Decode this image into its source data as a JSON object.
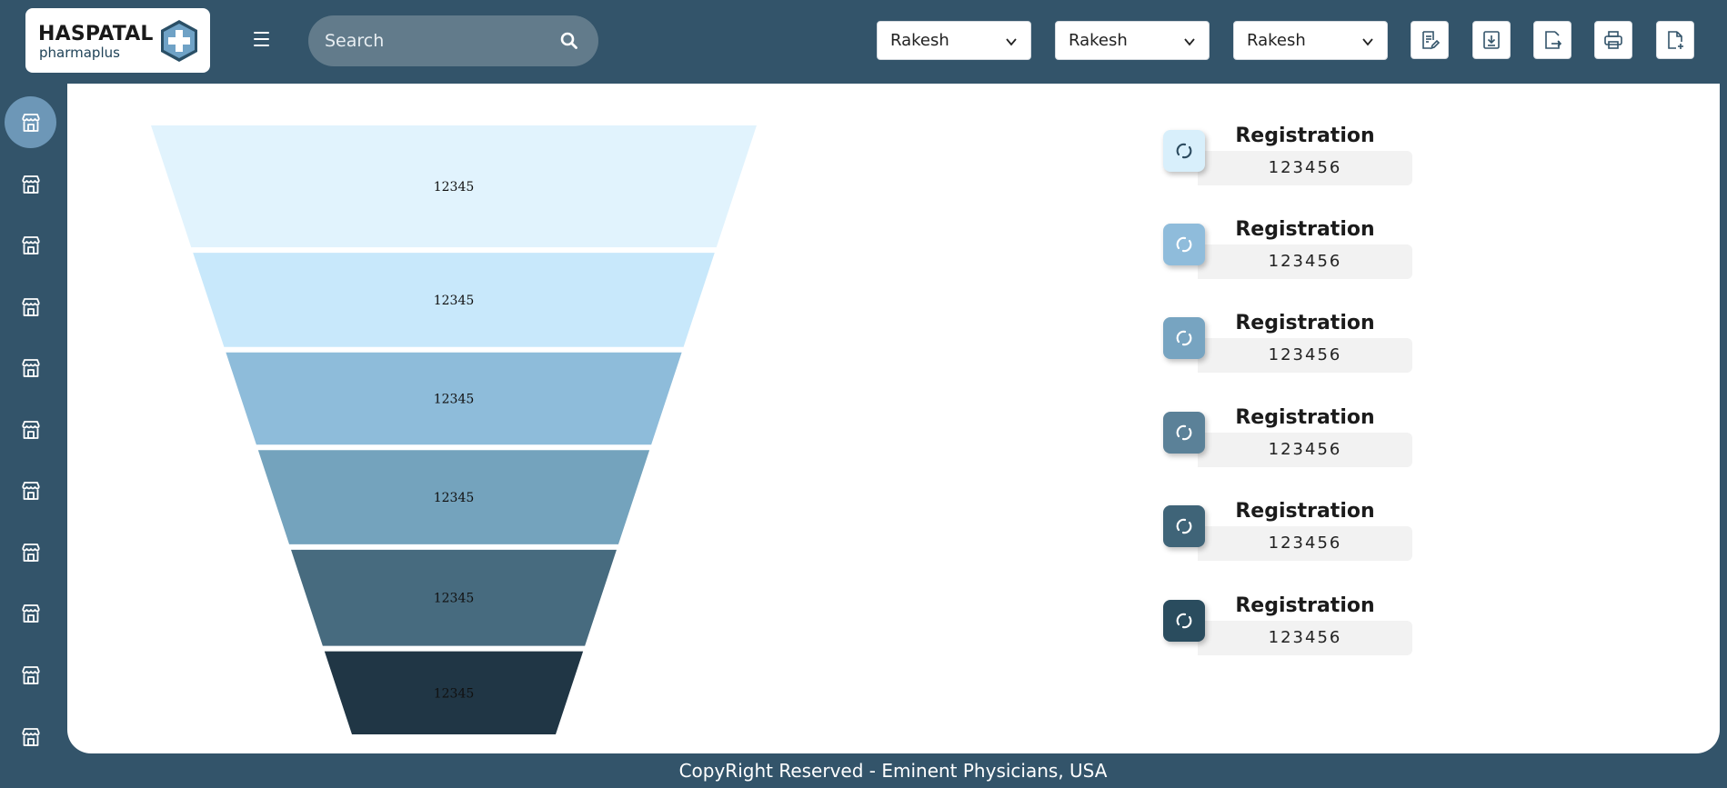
{
  "header": {
    "logo": {
      "title": "HASPATAL",
      "subtitle": "pharmaplus"
    },
    "search": {
      "placeholder": "Search"
    },
    "dropdowns": [
      {
        "value": "Rakesh"
      },
      {
        "value": "Rakesh"
      },
      {
        "value": "Rakesh"
      }
    ],
    "tools": [
      "edit-report-icon",
      "download-icon",
      "export-icon",
      "print-icon",
      "new-file-icon"
    ]
  },
  "sidebar": {
    "items": [
      {
        "icon": "store-icon",
        "active": true
      },
      {
        "icon": "store-icon",
        "active": false
      },
      {
        "icon": "store-icon",
        "active": false
      },
      {
        "icon": "store-icon",
        "active": false
      },
      {
        "icon": "store-icon",
        "active": false
      },
      {
        "icon": "store-icon",
        "active": false
      },
      {
        "icon": "store-icon",
        "active": false
      },
      {
        "icon": "store-icon",
        "active": false
      },
      {
        "icon": "store-icon",
        "active": false
      },
      {
        "icon": "store-icon",
        "active": false
      },
      {
        "icon": "store-icon",
        "active": false
      }
    ]
  },
  "chart_data": {
    "type": "funnel",
    "stages": [
      {
        "label": "12345",
        "color": "#e1f3fd"
      },
      {
        "label": "12345",
        "color": "#c8e8fb"
      },
      {
        "label": "12345",
        "color": "#8ebcda"
      },
      {
        "label": "12345",
        "color": "#74a3bd"
      },
      {
        "label": "12345",
        "color": "#476b7f"
      },
      {
        "label": "12345",
        "color": "#203645"
      }
    ]
  },
  "stats": [
    {
      "label": "Registration",
      "value": "123456",
      "icon": "link-icon",
      "color": "#d8effb"
    },
    {
      "label": "Registration",
      "value": "123456",
      "icon": "link-icon",
      "color": "#8fbcdb"
    },
    {
      "label": "Registration",
      "value": "123456",
      "icon": "link-icon",
      "color": "#77a4c1"
    },
    {
      "label": "Registration",
      "value": "123456",
      "icon": "link-icon",
      "color": "#5b8198"
    },
    {
      "label": "Registration",
      "value": "123456",
      "icon": "link-icon",
      "color": "#3f6478"
    },
    {
      "label": "Registration",
      "value": "123456",
      "icon": "link-icon",
      "color": "#2a4c5e"
    }
  ],
  "footer": {
    "text": "CopyRight Reserved - Eminent Physicians, USA"
  }
}
